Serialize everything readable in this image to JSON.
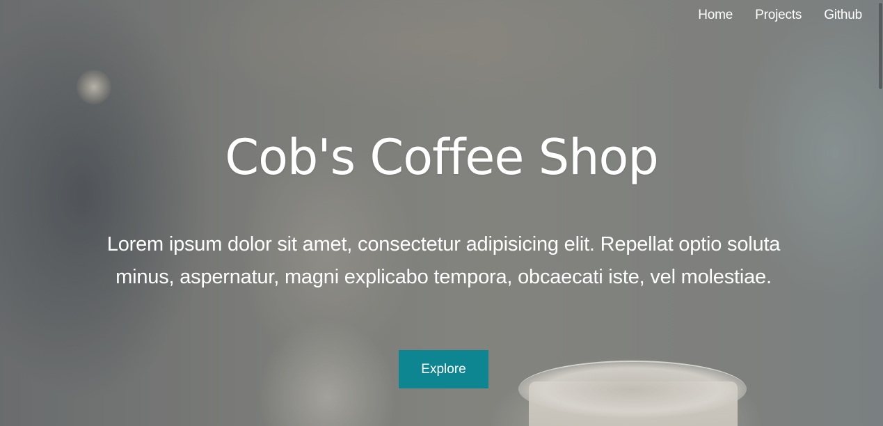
{
  "nav": {
    "items": [
      {
        "label": "Home"
      },
      {
        "label": "Projects"
      },
      {
        "label": "Github"
      }
    ]
  },
  "hero": {
    "title": "Cob's Coffee Shop",
    "description": "Lorem ipsum dolor sit amet, consectetur adipisicing elit. Repellat optio soluta minus, aspernatur, magni explicabo tempora, obcaecati iste, vel molestiae.",
    "button_label": "Explore"
  },
  "colors": {
    "accent": "#0e8691",
    "text": "#ffffff"
  },
  "icons": {
    "background": "coffee-shop-background-image"
  }
}
